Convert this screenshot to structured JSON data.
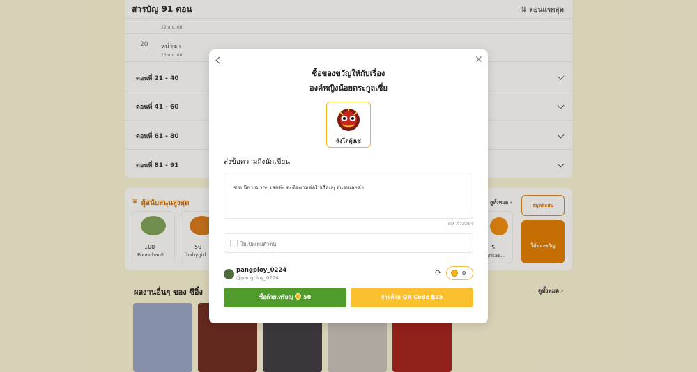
{
  "background": {
    "toc": {
      "header": "สารบัญ 91 ตอน",
      "sort_label": "⇅ ตอนแรกสุด",
      "episodes": [
        {
          "date": "22 พ.ย. 68"
        },
        {
          "number": "20",
          "title": "หน่าชา",
          "date": "23 พ.ย. 68"
        }
      ],
      "ranges": [
        "ตอนที่ 21 - 40",
        "ตอนที่ 41 - 60",
        "ตอนที่ 61 - 80",
        "ตอนที่ 81 - 91"
      ]
    },
    "supporters": {
      "title": "ผู้สนับสนุนสูงสุด",
      "see_all": "ดูทั้งหมด ›",
      "items": [
        {
          "amount": "100",
          "name": "Poonchanit"
        },
        {
          "amount": "50",
          "name": "babygirl"
        }
      ],
      "partial_item": {
        "amount": "5",
        "name": "arisa6..."
      },
      "book_button": "สมุดสะสม",
      "gift_button": "ให้ของขวัญ"
    },
    "other_works": {
      "title": "ผลงานอื่นๆ ของ ซีอิ๋ง",
      "see_all": "ดูทั้งหมด ›"
    }
  },
  "modal": {
    "title_line1": "ซื้อของขวัญให้กับเรื่อง",
    "title_line2": "องค์หญิงน้อยตระกูลเซี่ย",
    "gift_name": "สิงโตคุ้งเช่",
    "message_label": "ส่งข้อความถึงนักเขียน",
    "message_text": "ชอบนิยายมากๆ เลยค่ะ จะติดตามต่อไปเรื่อยๆ จนจบเลยค่า",
    "char_count": "89 ตัวอักษร",
    "anonymous_label": "ไม่เปิดเผยตัวตน",
    "user": {
      "name": "pangploy_0224",
      "handle": "@pangploy_0224"
    },
    "coin_balance": "0",
    "buy_with_coins_label": "ซื้อด้วยเหรียญ",
    "coin_price": "50",
    "pay_qr_label": "จ่ายด้วย QR Code ฿25"
  },
  "colors": {
    "primary_green": "#4f9b2c",
    "accent_yellow": "#fbc02d",
    "brand_orange": "#e57d00",
    "background_cream": "#fbf4d8"
  }
}
